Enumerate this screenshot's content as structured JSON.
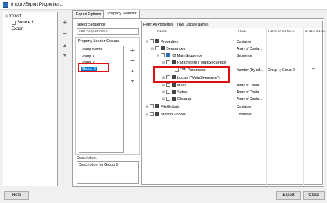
{
  "window": {
    "title": "Import/Export Properties..."
  },
  "left_tree": {
    "items": [
      {
        "label": "Import"
      },
      {
        "label": "Source 1"
      },
      {
        "label": "Export"
      }
    ]
  },
  "side_buttons": {
    "add": "+",
    "remove": "−",
    "up": "▲",
    "down": "▼"
  },
  "tabs": [
    {
      "label": "Export Options"
    },
    {
      "label": "Property Selector"
    }
  ],
  "property_selector": {
    "select_sequence_label": "Select Sequence:",
    "select_sequence_value": "<All Sequences>",
    "loader_groups_label": "Property Loader Groups",
    "group_list": [
      "Group Name",
      "Group 1",
      "Group 2",
      "Group 3"
    ],
    "group_buttons": {
      "add": "+",
      "remove": "−",
      "up": "▲",
      "down": "▼"
    },
    "description_label": "Description:",
    "description_value": "Description for Group 3"
  },
  "property_panel": {
    "filter_label": "Filter: All Properties",
    "view_label": "View: Display Names",
    "columns": [
      "NAME",
      "TYPE",
      "GROUP NAMES",
      "ALIAS NAME"
    ],
    "rows": [
      {
        "name": "Properties",
        "type": "Container",
        "groups": "",
        "alias": ""
      },
      {
        "name": "Sequences",
        "type": "Array of Contai...",
        "groups": "",
        "alias": ""
      },
      {
        "name": "[0] MainSequence",
        "type": "Sequence",
        "groups": "",
        "alias": ""
      },
      {
        "name": "Parameters (\"MainSequence\")",
        "type": "",
        "groups": "",
        "alias": ""
      },
      {
        "name": "Parameter",
        "type": "Number (By ref...",
        "groups": "Group 1; Group 2",
        "alias": "\"\""
      },
      {
        "name": "Locals (\"MainSequence\")",
        "type": "",
        "groups": "",
        "alias": ""
      },
      {
        "name": "Main",
        "type": "Array of Contai...",
        "groups": "",
        "alias": ""
      },
      {
        "name": "Setup",
        "type": "Array of Contai...",
        "groups": "",
        "alias": ""
      },
      {
        "name": "Cleanup",
        "type": "Array of Contai...",
        "groups": "",
        "alias": ""
      },
      {
        "name": "FileGlobals",
        "type": "Container",
        "groups": "",
        "alias": ""
      },
      {
        "name": "StationGlobals",
        "type": "Container",
        "groups": "",
        "alias": ""
      }
    ],
    "expanders": [
      "⊟",
      "⊟",
      "⊟",
      "⊟",
      "",
      "⊞",
      "⊞",
      "⊞",
      "⊞",
      "⊞",
      "⊞"
    ],
    "icon_badge": "123"
  },
  "bottom": {
    "help": "Help",
    "export": "Export",
    "close": "Close"
  },
  "colors": {
    "highlight_box": "#e01010",
    "selection": "#0078d7"
  }
}
